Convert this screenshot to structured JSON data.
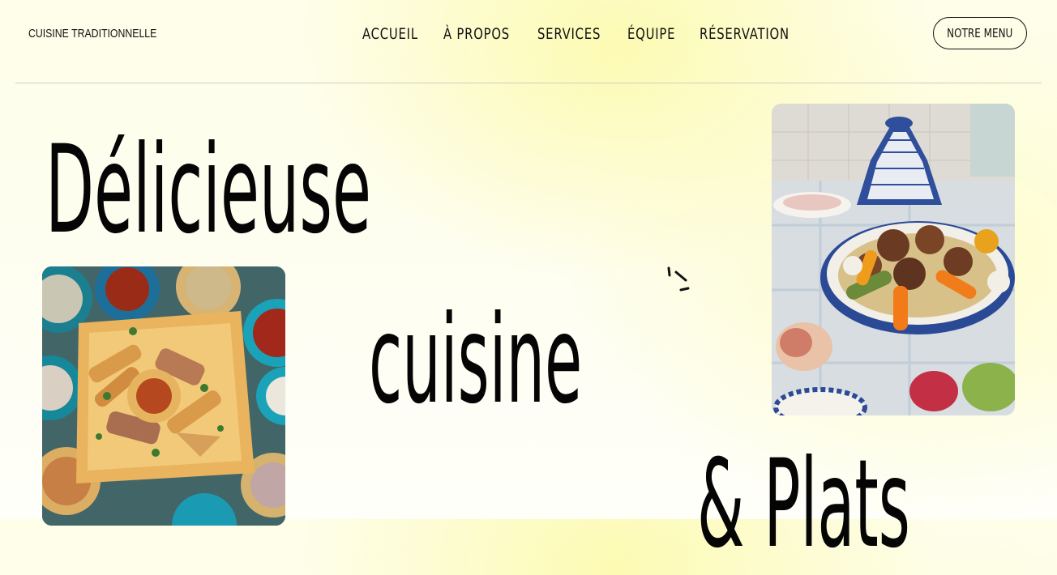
{
  "header": {
    "brand": "CUISINE TRADITIONNELLE",
    "nav": [
      "ACCUEIL",
      "À PROPOS",
      "SERVICES",
      "ÉQUIPE",
      "RÉSERVATION"
    ],
    "cta_label": "NOTRE MENU"
  },
  "hero": {
    "word1": "Délicieuse",
    "word2": "cuisine",
    "word3": "& Plats"
  },
  "images": {
    "left": "food-platter-photo",
    "right": "couscous-tagine-photo"
  },
  "colors": {
    "background": "#fefee9",
    "highlight": "#fcfaaf",
    "text": "#050505"
  }
}
